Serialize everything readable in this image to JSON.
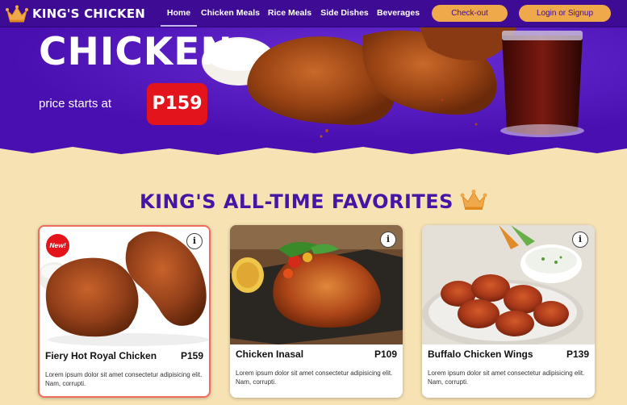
{
  "brand": {
    "name": "KING'S CHICKEN",
    "icon": "crown-icon"
  },
  "nav": {
    "links": [
      {
        "label": "Home",
        "active": true
      },
      {
        "label": "Chicken Meals",
        "active": false
      },
      {
        "label": "Rice Meals",
        "active": false
      },
      {
        "label": "Side Dishes",
        "active": false
      },
      {
        "label": "Beverages",
        "active": false
      }
    ],
    "checkout_label": "Check-out",
    "login_label": "Login or Signup"
  },
  "hero": {
    "title": "CHICKEN",
    "subtitle": "price starts at",
    "price": "P159"
  },
  "favorites": {
    "title": "KING'S ALL-TIME FAVORITES",
    "icon": "crown-icon",
    "cards": [
      {
        "name": "Fiery Hot Royal Chicken",
        "price": "P159",
        "badge": "New!",
        "info": "i",
        "description": "Lorem ipsum dolor sit amet consectetur adipisicing elit. Nam, corrupti."
      },
      {
        "name": "Chicken Inasal",
        "price": "P109",
        "info": "i",
        "description": "Lorem ipsum dolor sit amet consectetur adipisicing elit. Nam, corrupti."
      },
      {
        "name": "Buffalo Chicken Wings",
        "price": "P139",
        "info": "i",
        "description": "Lorem ipsum dolor sit amet consectetur adipisicing elit. Nam, corrupti."
      }
    ]
  },
  "colors": {
    "nav_bg": "#3d0b94",
    "hero_bg": "#4a0fb0",
    "page_bg": "#f6e2b3",
    "accent_orange": "#f0a94a",
    "price_red": "#e3141c",
    "title_purple": "#4516a5"
  }
}
